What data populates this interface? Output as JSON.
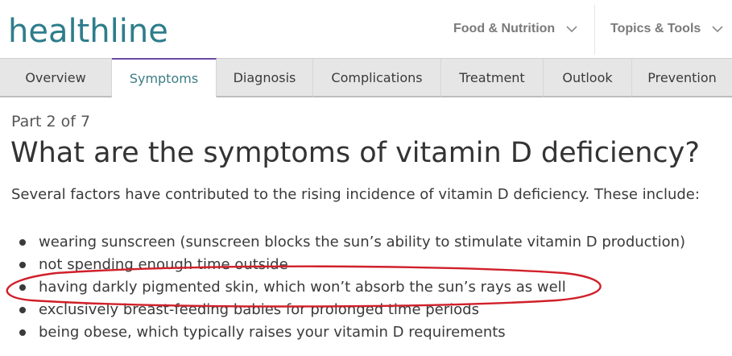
{
  "brand": {
    "logo_text": "healthline",
    "accent": "#2e7d8c",
    "tab_active_border": "#6b4ba3"
  },
  "header": {
    "nav": [
      {
        "label": "Food & Nutrition",
        "icon": "chevron-down-icon"
      },
      {
        "label": "Topics & Tools",
        "icon": "chevron-down-icon"
      }
    ]
  },
  "tabs": [
    {
      "label": "Overview",
      "active": false
    },
    {
      "label": "Symptoms",
      "active": true
    },
    {
      "label": "Diagnosis",
      "active": false
    },
    {
      "label": "Complications",
      "active": false
    },
    {
      "label": "Treatment",
      "active": false
    },
    {
      "label": "Outlook",
      "active": false
    },
    {
      "label": "Prevention",
      "active": false
    }
  ],
  "article": {
    "part": "Part 2 of 7",
    "title": "What are the symptoms of vitamin D deficiency?",
    "intro": "Several factors have contributed to the rising incidence of vitamin D deficiency. These include:",
    "items": [
      "wearing sunscreen (sunscreen blocks the sun’s ability to stimulate vitamin D production)",
      "not spending enough time outside",
      "having darkly pigmented skin, which won’t absorb the sun’s rays as well",
      "exclusively breast-feeding babies for prolonged time periods",
      "being obese, which typically raises your vitamin D requirements"
    ]
  },
  "annotation": {
    "color": "#d0202a",
    "circled_item_index": 2
  }
}
